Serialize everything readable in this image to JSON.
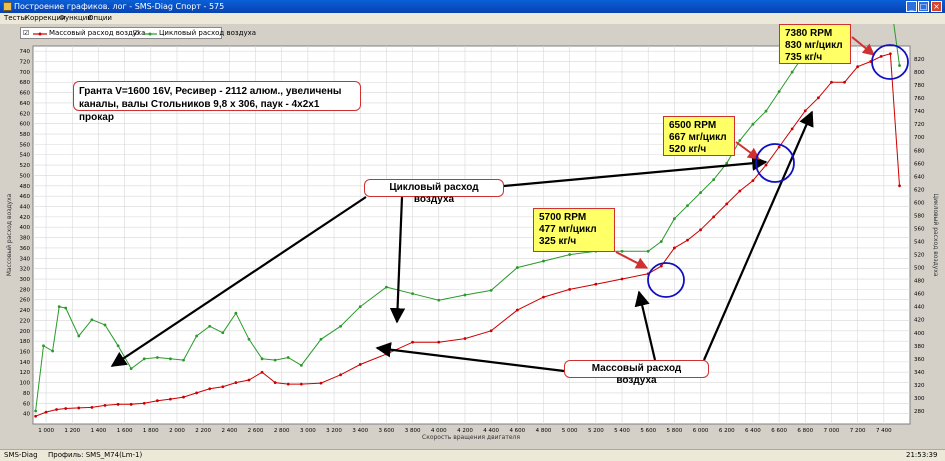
{
  "window": {
    "title": "Построение графиков. лог - SMS-Diag Спорт - 575"
  },
  "menu": {
    "items": [
      "Тесты",
      "Коррекции",
      "Функции",
      "Опции"
    ]
  },
  "status": {
    "left": "SMS-Diag",
    "profile": "Профиль: SMS_M74(Lm-1)",
    "time": "21:53:39"
  },
  "annotations": {
    "note": [
      "Гранта V=1600 16V, Ресивер - 2112 алюм., увеличены",
      "каналы, валы Стольников 9,8 х 306, паук - 4х2х1 прокар"
    ],
    "box1": [
      "5700 RPM",
      "477 мг/цикл",
      "325 кг/ч"
    ],
    "box2": [
      "6500 RPM",
      "667 мг/цикл",
      "520 кг/ч"
    ],
    "box3": [
      "7380 RPM",
      "830 мг/цикл",
      "735 кг/ч"
    ],
    "label_cycle": "Цикловый расход воздуха",
    "label_mass": "Массовый расход воздуха"
  },
  "colors": {
    "mass": "#cc0000",
    "cycle": "#2a9a2a",
    "annot": "#d03030",
    "circle": "#1010c0",
    "plot_bg": "#ffffff"
  },
  "chart_data": {
    "type": "line",
    "title": "",
    "xlabel": "Скорость вращения двигателя",
    "ylabel": "Массовый расход воздуха",
    "y2label": "Цикловый расход воздуха",
    "xlim": [
      900,
      7600
    ],
    "ylim": [
      20,
      750
    ],
    "y2lim": [
      260,
      840
    ],
    "xticks": [
      1000,
      1200,
      1400,
      1600,
      1800,
      2000,
      2200,
      2400,
      2600,
      2800,
      3000,
      3200,
      3400,
      3600,
      3800,
      4000,
      4200,
      4400,
      4600,
      4800,
      5000,
      5200,
      5400,
      5600,
      5800,
      6000,
      6200,
      6400,
      6600,
      6800,
      7000,
      7200,
      7400
    ],
    "xtick_labels": [
      "1 000",
      "1 200",
      "1 400",
      "1 600",
      "1 800",
      "2 000",
      "2 200",
      "2 400",
      "2 600",
      "2 800",
      "3 000",
      "3 200",
      "3 400",
      "3 600",
      "3 800",
      "4 000",
      "4 200",
      "4 400",
      "4 600",
      "4 800",
      "5 000",
      "5 200",
      "5 400",
      "5 600",
      "5 800",
      "6 000",
      "6 200",
      "6 400",
      "6 600",
      "6 800",
      "7 000",
      "7 200",
      "7 400"
    ],
    "yticks": [
      40,
      60,
      80,
      100,
      120,
      140,
      160,
      180,
      200,
      220,
      240,
      260,
      280,
      300,
      320,
      340,
      360,
      380,
      400,
      420,
      440,
      460,
      480,
      500,
      520,
      540,
      560,
      580,
      600,
      620,
      640,
      660,
      680,
      700,
      720,
      740
    ],
    "y2ticks": [
      280,
      300,
      320,
      340,
      360,
      380,
      400,
      420,
      440,
      460,
      480,
      500,
      520,
      540,
      560,
      580,
      600,
      620,
      640,
      660,
      680,
      700,
      720,
      740,
      760,
      780,
      800,
      820
    ],
    "grid": true,
    "legend_position": "top-left",
    "series": [
      {
        "name": "Массовый расход воздуха",
        "axis": "left",
        "color": "#cc0000",
        "x": [
          920,
          1000,
          1080,
          1150,
          1250,
          1350,
          1450,
          1550,
          1650,
          1750,
          1850,
          1950,
          2050,
          2150,
          2250,
          2350,
          2450,
          2550,
          2650,
          2750,
          2850,
          2950,
          3100,
          3250,
          3400,
          3600,
          3800,
          4000,
          4200,
          4400,
          4600,
          4800,
          5000,
          5200,
          5400,
          5600,
          5700,
          5800,
          5900,
          6000,
          6100,
          6200,
          6300,
          6400,
          6500,
          6600,
          6700,
          6800,
          6900,
          7000,
          7100,
          7200,
          7300,
          7380,
          7450,
          7520
        ],
        "y": [
          35,
          43,
          48,
          50,
          51,
          52,
          56,
          58,
          58,
          60,
          65,
          68,
          72,
          80,
          88,
          92,
          100,
          105,
          120,
          100,
          97,
          97,
          99,
          115,
          135,
          155,
          178,
          178,
          185,
          200,
          240,
          265,
          280,
          290,
          300,
          310,
          325,
          360,
          375,
          395,
          420,
          445,
          470,
          490,
          520,
          555,
          590,
          625,
          650,
          680,
          680,
          710,
          720,
          730,
          735,
          480
        ]
      },
      {
        "name": "Цикловый расход воздуха",
        "axis": "right",
        "color": "#2a9a2a",
        "x": [
          920,
          980,
          1050,
          1100,
          1150,
          1250,
          1350,
          1450,
          1550,
          1650,
          1750,
          1850,
          1950,
          2050,
          2150,
          2250,
          2350,
          2450,
          2550,
          2650,
          2750,
          2850,
          2950,
          3100,
          3250,
          3400,
          3600,
          3800,
          4000,
          4200,
          4400,
          4600,
          4800,
          5000,
          5200,
          5400,
          5600,
          5700,
          5800,
          5900,
          6000,
          6100,
          6200,
          6300,
          6400,
          6500,
          6600,
          6700,
          6800,
          6900,
          7000,
          7100,
          7200,
          7300,
          7380,
          7450,
          7520
        ],
        "y": [
          280,
          380,
          372,
          440,
          438,
          395,
          420,
          412,
          380,
          345,
          360,
          362,
          360,
          358,
          395,
          410,
          400,
          430,
          390,
          360,
          358,
          362,
          350,
          390,
          410,
          440,
          470,
          460,
          450,
          458,
          465,
          500,
          510,
          520,
          525,
          525,
          525,
          540,
          575,
          595,
          615,
          635,
          660,
          695,
          720,
          740,
          770,
          800,
          830,
          855,
          870,
          870,
          900,
          905,
          910,
          912,
          810
        ]
      }
    ]
  }
}
